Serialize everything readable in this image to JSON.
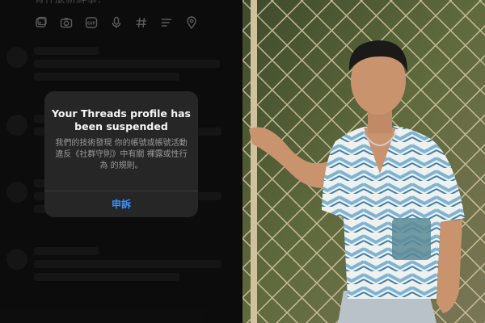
{
  "composer": {
    "placeholder_partial": "有什麼新鮮事？"
  },
  "toolbar": {
    "icons": [
      "gallery-icon",
      "camera-icon",
      "gif-icon",
      "mic-icon",
      "hashtag-icon",
      "list-icon",
      "location-icon"
    ]
  },
  "dialog": {
    "title": "Your Threads profile has been suspended",
    "body": "我們的技術發現 你的帳號或帳號活動違反《社群守則》中有關 裸露或性行為 的規則。",
    "button": "申訴"
  },
  "colors": {
    "app_background": "#111111",
    "dialog_background": "#262626",
    "accent_link": "#3d8ff4"
  }
}
